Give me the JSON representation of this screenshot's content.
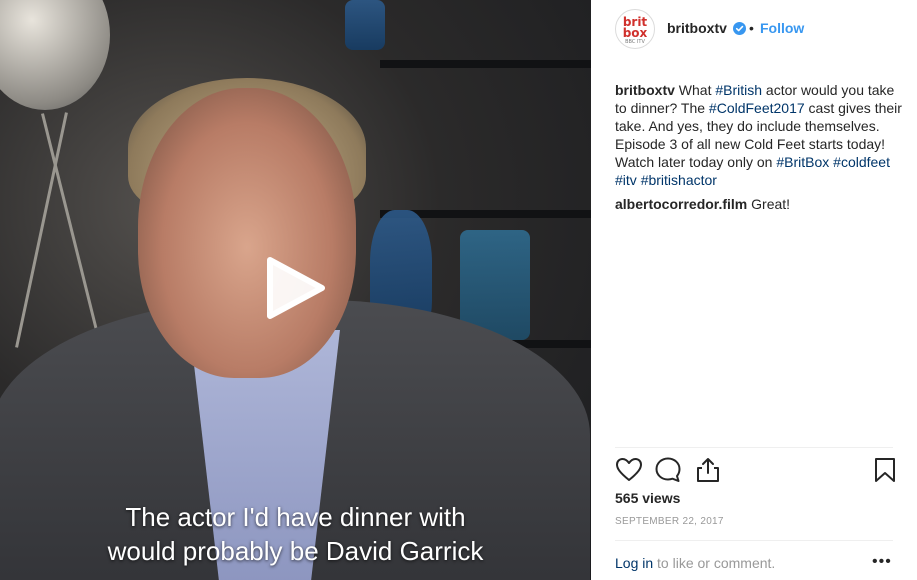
{
  "post": {
    "username": "britboxtv",
    "follow_label": "Follow",
    "separator": "•",
    "avatar": {
      "line1": "brit",
      "line2": "box",
      "line3": "BBC ITV"
    },
    "caption": {
      "username": "britboxtv",
      "text1": " What ",
      "tag1": "#British",
      "text2": " actor would you take to dinner? The ",
      "tag2": "#ColdFeet2017",
      "text3": " cast gives their take. And yes, they do include themselves. Episode 3 of all new Cold Feet starts today! Watch later today only on ",
      "tag3": "#BritBox",
      "tag4": "#coldfeet",
      "tag5": "#itv",
      "tag6": "#britishactor"
    },
    "comment": {
      "username": "albertocorredor.film",
      "text": " Great!"
    },
    "views": "565 views",
    "date": "SEPTEMBER 22, 2017",
    "login": {
      "link": "Log in",
      "rest": " to like or comment."
    },
    "more": "•••"
  },
  "video": {
    "subtitle_line1": "The actor I'd have dinner with",
    "subtitle_line2": "would probably be David Garrick"
  },
  "colors": {
    "accent": "#3897f0",
    "hashtag": "#003569",
    "muted": "#999999"
  }
}
